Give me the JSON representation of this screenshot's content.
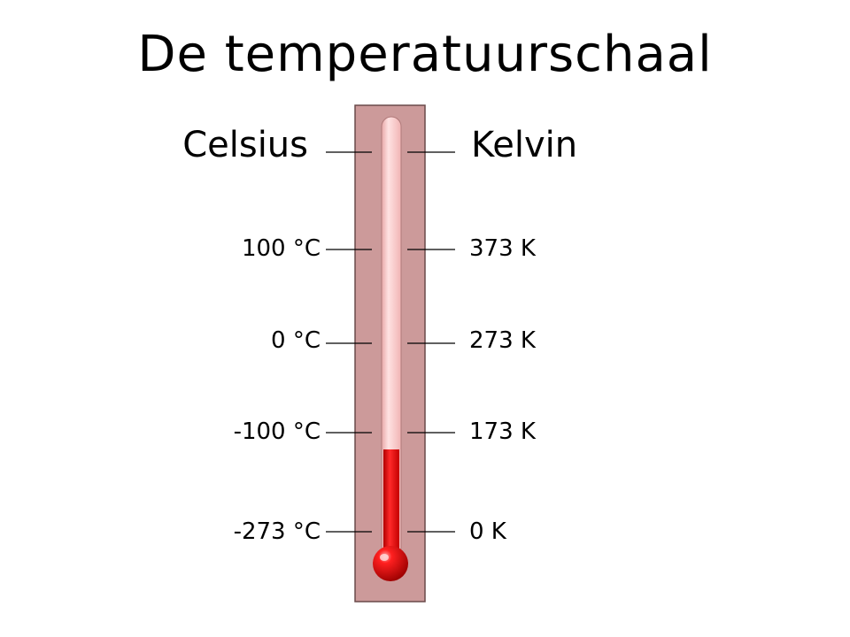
{
  "title": "De temperatuurschaal",
  "scales": {
    "left_heading": "Celsius",
    "right_heading": "Kelvin",
    "celsius": [
      "100 °C",
      "0 °C",
      "-100 °C",
      "-273 °C"
    ],
    "kelvin": [
      "373 K",
      "273 K",
      "173 K",
      "0 K"
    ]
  },
  "colors": {
    "board": "#cc9a9a",
    "tube": "#f7c6c6",
    "mercury": "#dd0000",
    "ticks": "#000000"
  }
}
